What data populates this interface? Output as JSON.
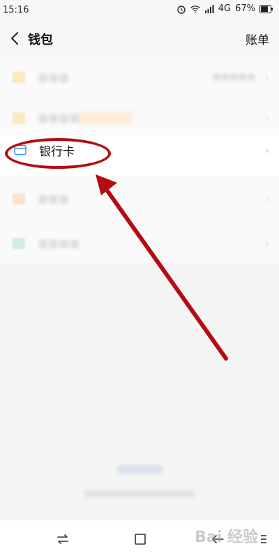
{
  "status_bar": {
    "time": "15:16",
    "network": "4G",
    "battery": "67%"
  },
  "header": {
    "title": "钱包",
    "bill_label": "账单"
  },
  "list": {
    "bank_card_label": "银行卡"
  },
  "colors": {
    "highlight_ellipse": "#b30c12",
    "arrow": "#b30c12",
    "card_icon": "#3a8ee6"
  },
  "watermark": "Bai 经验"
}
